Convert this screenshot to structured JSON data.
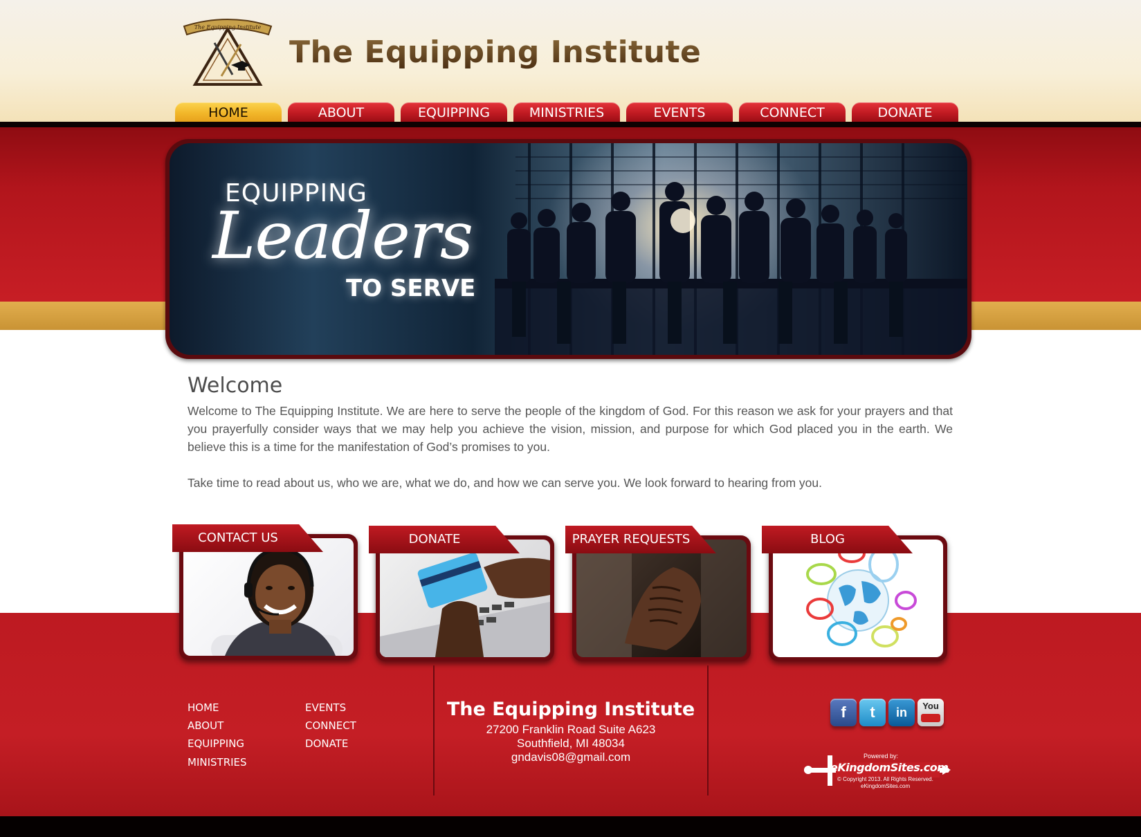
{
  "site": {
    "logo_text": "The Equipping Institute",
    "title": "The Equipping Institute"
  },
  "nav": {
    "items": [
      {
        "label": "HOME",
        "active": true
      },
      {
        "label": "ABOUT"
      },
      {
        "label": "EQUIPPING"
      },
      {
        "label": "MINISTRIES"
      },
      {
        "label": "EVENTS"
      },
      {
        "label": "CONNECT"
      },
      {
        "label": "DONATE"
      }
    ]
  },
  "hero": {
    "line1": "EQUIPPING",
    "line2": "Leaders",
    "line3": "TO SERVE"
  },
  "welcome": {
    "heading": "Welcome",
    "paragraph1": "Welcome to The Equipping Institute. We are here to serve the people of the kingdom of God. For this reason we ask for your prayers and that you prayerfully consider ways that we may help you achieve the vision, mission, and purpose for which God placed you in the earth. We believe this is a time for the manifestation of God’s promises to you.",
    "paragraph2": "Take time to read about us, who we are, what we do, and how we can serve you. We look forward to hearing from you."
  },
  "cards": [
    {
      "label": "CONTACT US"
    },
    {
      "label": "DONATE"
    },
    {
      "label": "PRAYER REQUESTS"
    },
    {
      "label": "BLOG"
    }
  ],
  "footer": {
    "links": [
      "HOME",
      "ABOUT",
      "EQUIPPING",
      "MINISTRIES",
      "EVENTS",
      "CONNECT",
      "DONATE"
    ],
    "org_name": "The Equipping Institute",
    "address1": "27200 Franklin Road Suite A623",
    "address2": "Southfield, MI 48034",
    "email": "gndavis08@gmail.com",
    "social": [
      {
        "name": "facebook-icon",
        "glyph": "f",
        "color": "#3b5998"
      },
      {
        "name": "twitter-icon",
        "glyph": "t",
        "color": "#2aa3e0"
      },
      {
        "name": "linkedin-icon",
        "glyph": "in",
        "color": "#0a73b7"
      },
      {
        "name": "youtube-icon",
        "glyph": "You",
        "color": "#cc1f1f"
      }
    ],
    "powered_label": "Powered by:",
    "powered_brand": "eKingdomSites.com",
    "copyright": "© Copyright 2013. All Rights Reserved.",
    "powered_site": "eKingdomSites.com"
  },
  "colors": {
    "brand_red": "#c41e25",
    "nav_active": "#f2b72a",
    "gold_band": "#d9a444",
    "title_brown": "#5c3a18"
  }
}
